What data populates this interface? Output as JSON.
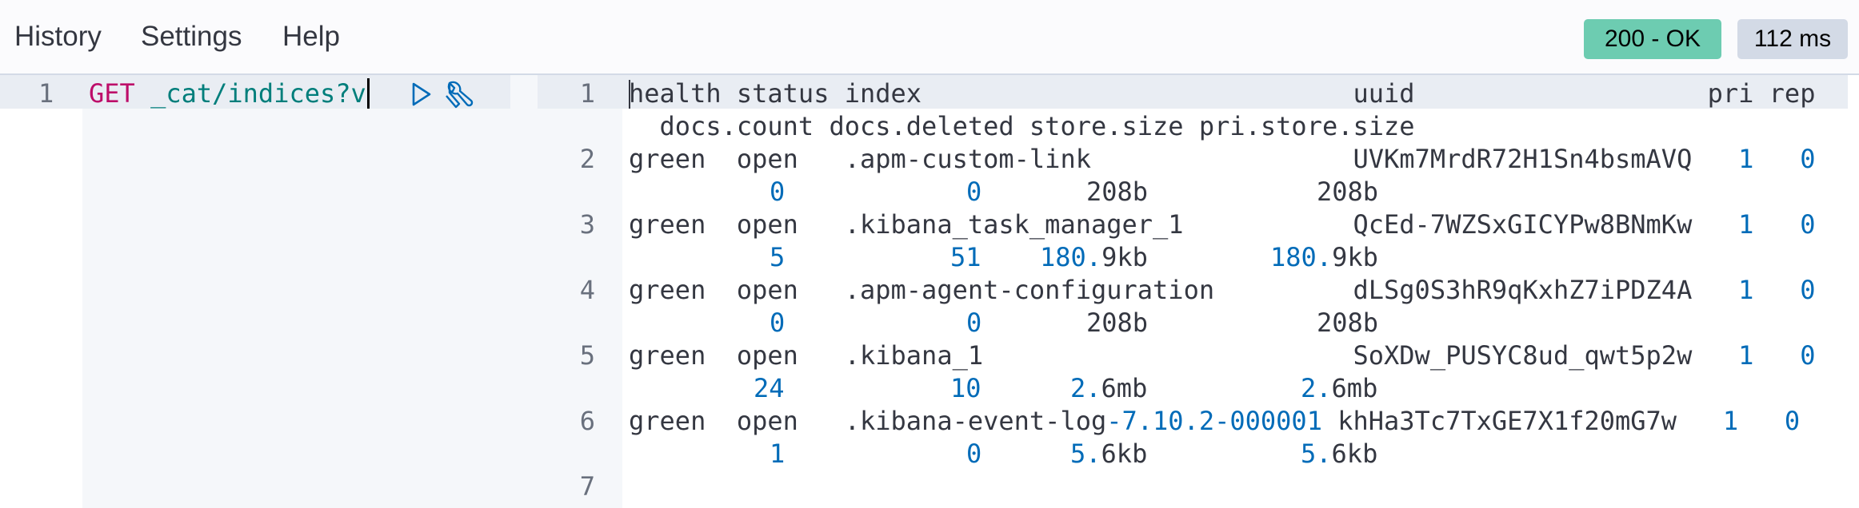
{
  "menu": {
    "history": "History",
    "settings": "Settings",
    "help": "Help"
  },
  "status": {
    "code": "200 - OK",
    "time": "112 ms"
  },
  "request": {
    "line_number": "1",
    "method": "GET",
    "path": "_cat/indices?v",
    "icons": {
      "run": "play-icon",
      "settings": "wrench-icon"
    }
  },
  "response": {
    "line_numbers": [
      "1",
      "2",
      "3",
      "4",
      "5",
      "6",
      "7"
    ],
    "header": {
      "part1": "health status index                            uuid                   ",
      "pri": "pri",
      "rep": "rep",
      "part2": "  docs.count docs.deleted store.size pri.store.size"
    },
    "rows": [
      {
        "prefix": "green  open   ",
        "index": ".apm-custom-link",
        "pad": "                 ",
        "uuid": "UVKm7MrdR72H1Sn4bsmAVQ",
        "pri": "1",
        "rep": "0",
        "docs_count": "0",
        "docs_deleted": "0",
        "store_size": "208b",
        "pri_store_size": "208b"
      },
      {
        "prefix": "green  open   ",
        "index": ".kibana_task_manager_1",
        "pad": "           ",
        "uuid": "QcEd-7WZSxGICYPw8BNmKw",
        "pri": "1",
        "rep": "0",
        "docs_count": "5",
        "docs_deleted": "51",
        "store_size_num": "180.",
        "store_size_unit": "9kb",
        "pri_store_size_num": "180.",
        "pri_store_size_unit": "9kb"
      },
      {
        "prefix": "green  open   ",
        "index": ".apm-agent-configuration",
        "pad": "         ",
        "uuid": "dLSg0S3hR9qKxhZ7iPDZ4A",
        "pri": "1",
        "rep": "0",
        "docs_count": "0",
        "docs_deleted": "0",
        "store_size": "208b",
        "pri_store_size": "208b"
      },
      {
        "prefix": "green  open   ",
        "index": ".kibana_1",
        "pad": "                        ",
        "uuid": "SoXDw_PUSYC8ud_qwt5p2w",
        "pri": "1",
        "rep": "0",
        "docs_count": "24",
        "docs_deleted": "10",
        "store_size_num": "2.",
        "store_size_unit": "6mb",
        "pri_store_size_num": "2.",
        "pri_store_size_unit": "6mb"
      },
      {
        "prefix": "green  open   ",
        "index_a": ".kibana-event-log",
        "index_b": "-7.10.2-000001",
        "pad": " ",
        "uuid": "khHa3Tc7TxGE7X1f20mG7w",
        "pri": "1",
        "rep": "0",
        "docs_count": "1",
        "docs_deleted": "0",
        "store_size_num": "5.",
        "store_size_unit": "6kb",
        "pri_store_size_num": "5.",
        "pri_store_size_unit": "6kb"
      }
    ]
  },
  "colors": {
    "method": "#bd0d69",
    "path": "#007e7b",
    "number": "#006bb8",
    "status_ok": "#6dccb1",
    "time_badge": "#d3dae6"
  }
}
